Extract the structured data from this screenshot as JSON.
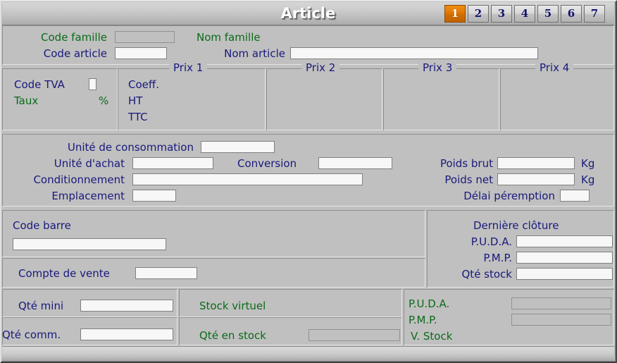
{
  "window": {
    "title": "Article"
  },
  "tabs": [
    {
      "label": "1",
      "active": true
    },
    {
      "label": "2",
      "active": false
    },
    {
      "label": "3",
      "active": false
    },
    {
      "label": "4",
      "active": false
    },
    {
      "label": "5",
      "active": false
    },
    {
      "label": "6",
      "active": false
    },
    {
      "label": "7",
      "active": false
    }
  ],
  "identity": {
    "code_famille_label": "Code famille",
    "code_famille_value": "",
    "nom_famille_label": "Nom famille",
    "nom_famille_value": "",
    "code_article_label": "Code article",
    "code_article_value": "",
    "nom_article_label": "Nom article",
    "nom_article_value": ""
  },
  "tva": {
    "code_tva_label": "Code TVA",
    "code_tva_value": "",
    "taux_label": "Taux",
    "taux_value": "",
    "percent_symbol": "%"
  },
  "prix": {
    "groups": [
      {
        "legend": "Prix 1"
      },
      {
        "legend": "Prix 2"
      },
      {
        "legend": "Prix 3"
      },
      {
        "legend": "Prix 4"
      }
    ],
    "rows": [
      {
        "label": "Coeff.",
        "value": ""
      },
      {
        "label": "HT",
        "value": ""
      },
      {
        "label": "TTC",
        "value": ""
      }
    ]
  },
  "units": {
    "unite_consommation_label": "Unité de consommation",
    "unite_consommation_value": "",
    "unite_achat_label": "Unité d'achat",
    "unite_achat_value": "",
    "conversion_label": "Conversion",
    "conversion_value": "",
    "conditionnement_label": "Conditionnement",
    "conditionnement_value": "",
    "emplacement_label": "Emplacement",
    "emplacement_value": ""
  },
  "weights": {
    "poids_brut_label": "Poids brut",
    "poids_brut_value": "",
    "poids_brut_unit": "Kg",
    "poids_net_label": "Poids net",
    "poids_net_value": "",
    "poids_net_unit": "Kg",
    "delai_peremption_label": "Délai péremption",
    "delai_peremption_value": ""
  },
  "barcode": {
    "code_barre_label": "Code barre",
    "code_barre_value": "",
    "compte_vente_label": "Compte de vente",
    "compte_vente_value": ""
  },
  "cloture": {
    "title": "Dernière clôture",
    "puda_label": "P.U.D.A.",
    "puda_value": "",
    "pmp_label": "P.M.P.",
    "pmp_value": "",
    "qte_stock_label": "Qté stock",
    "qte_stock_value": ""
  },
  "stock": {
    "qte_mini_label": "Qté mini",
    "qte_mini_value": "",
    "qte_comm_label": "Qté comm.",
    "qte_comm_value": "",
    "stock_virtuel_label": "Stock virtuel",
    "stock_virtuel_value": "",
    "qte_en_stock_label": "Qté en stock",
    "qte_en_stock_value": "",
    "puda_label": "P.U.D.A.",
    "puda_value": "",
    "pmp_label": "P.M.P.",
    "pmp_value": "",
    "v_stock_label": "V. Stock",
    "v_stock_value": ""
  },
  "colors": {
    "window_bg": "#c0c0c0",
    "label_blue": "#19197c",
    "label_green": "#0a6b18",
    "tab_active": "#e07800",
    "field_bg": "#f7f7f7"
  }
}
